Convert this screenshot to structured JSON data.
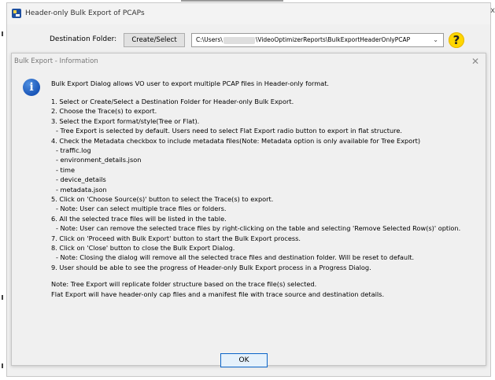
{
  "window": {
    "title": "Header-only Bulk Export of PCAPs",
    "close_glyph": "x"
  },
  "destination": {
    "label": "Destination Folder:",
    "button_label": "Create/Select",
    "path_prefix": "C:\\Users\\",
    "path_suffix": "\\VideoOptimizerReports\\BulkExportHeaderOnlyPCAP",
    "help_symbol": "?"
  },
  "info_dialog": {
    "title": "Bulk Export - Information",
    "close_glyph": "✕",
    "icon_letter": "i",
    "intro": "Bulk Export Dialog allows VO user to export multiple PCAP files in Header-only format.",
    "steps": [
      "1. Select or Create/Select a Destination Folder for Header-only Bulk Export.",
      "2. Choose the Trace(s) to export.",
      "3. Select the Export format/style(Tree or Flat).",
      "   - Tree Export is selected by default. Users need to select Flat Export radio button to export in flat structure.",
      "4. Check the Metadata checkbox to include metadata files(Note: Metadata option is only available for Tree Export)",
      "   - traffic.log",
      "   - environment_details.json",
      "   - time",
      "   - device_details",
      "   - metadata.json",
      "5. Click on 'Choose Source(s)' button to select the Trace(s) to export.",
      "   - Note: User can select multiple trace files or folders.",
      "6. All the selected trace files will be listed in the table.",
      "   - Note: User can remove the selected trace files by right-clicking on the table and selecting 'Remove Selected Row(s)' option.",
      "7. Click on 'Proceed with Bulk Export' button to start the Bulk Export process.",
      "8. Click on 'Close' button to close the Bulk Export Dialog.",
      "   - Note: Closing the dialog will remove all the selected trace files and destination folder. Will be reset to default.",
      "9. User should be able to see the progress of Header-only Bulk Export process in a Progress Dialog."
    ],
    "notes": [
      "Note: Tree Export will replicate folder structure based on the trace file(s) selected.",
      "Flat Export will have header-only cap files and a manifest file with trace source and destination details."
    ],
    "ok_label": "OK"
  }
}
